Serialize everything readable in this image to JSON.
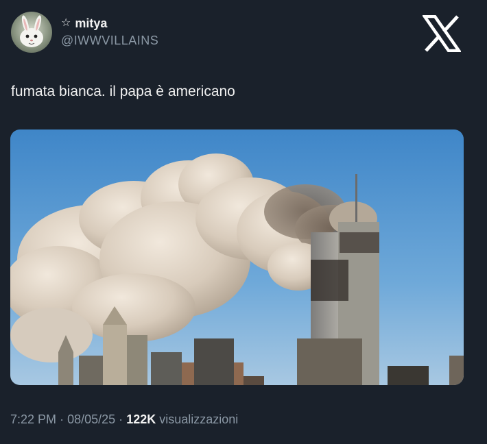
{
  "user": {
    "display_name": "mitya",
    "star_glyph": "☆",
    "handle": "@IWWVILLAINS",
    "avatar_icon": "white-rabbit-avatar"
  },
  "brand": {
    "logo_icon": "x-logo-icon"
  },
  "tweet": {
    "text": "fumata bianca. il papa è americano"
  },
  "media": {
    "description_icon": "photo-skyline-smoke"
  },
  "meta": {
    "time": "7:22 PM",
    "separator": "·",
    "date": "08/05/25",
    "views_count": "122K",
    "views_label": "visualizzazioni"
  },
  "colors": {
    "background": "#1a212b",
    "primary_text": "#e7e9ea",
    "secondary_text": "#8b98a5"
  }
}
